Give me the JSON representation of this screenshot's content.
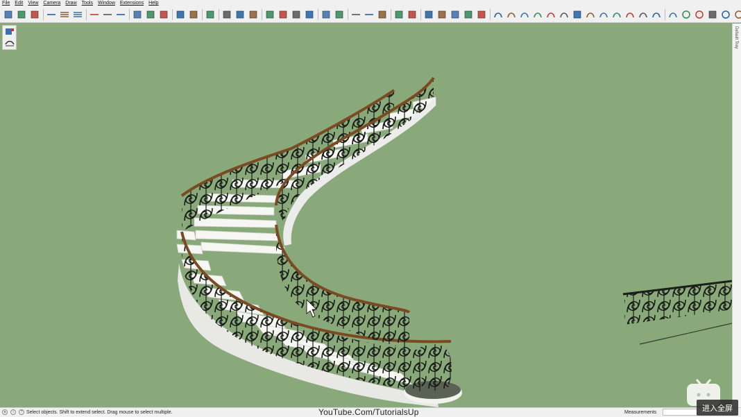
{
  "menu": [
    "File",
    "Edit",
    "View",
    "Camera",
    "Draw",
    "Tools",
    "Window",
    "Extensions",
    "Help"
  ],
  "toolbar_icons": [
    "select-icon",
    "component-icon",
    "make-group-icon",
    "sep",
    "layer-lines-icon",
    "layer-add-icon",
    "layer-del-icon",
    "sep",
    "line-short-icon",
    "line-add-icon",
    "line-remove-icon",
    "sep",
    "section-plane-icon",
    "section-fill-icon",
    "section-cut-icon",
    "sep",
    "grid-icon",
    "grid-blue-icon",
    "sep",
    "texture-grid-icon",
    "sep",
    "paint-table-icon",
    "paint-bucket-icon",
    "warehouse-icon",
    "sep",
    "checker-icon",
    "dots-icon",
    "network-icon",
    "share-icon",
    "sep",
    "grid-2x2-icon",
    "grid-quad-icon",
    "sep",
    "arrow-line-icon",
    "arrow-red-icon",
    "tile-icon",
    "sep",
    "pen-red-icon",
    "red-box-icon",
    "sep",
    "blue-diamond-icon",
    "eraser-icon",
    "warning-icon",
    "bucket-icon",
    "flag-icon",
    "sep",
    "arc-icon",
    "zigzag-icon",
    "scribble-icon",
    "wave-icon",
    "curve-icon",
    "hook-icon",
    "rounded-rect-icon",
    "spiral-icon",
    "arc-open-icon",
    "squiggle-icon",
    "corner-curve-icon",
    "small-arc-icon",
    "red-arc-icon",
    "sep",
    "zigzag-n-icon",
    "polygon-icon",
    "circle-icon",
    "wrench-icon",
    "circle-small-icon",
    "teardrop-icon"
  ],
  "mini_tools": [
    "view-icon",
    "rail-icon"
  ],
  "tray": {
    "label": "Default Tray"
  },
  "status": {
    "hint": "Select objects. Shift to extend select. Drag mouse to select multiple.",
    "measurements_label": "Measurements",
    "measurements_value": ""
  },
  "watermark": "YouTube.Com/TutorialsUp",
  "overlay": {
    "fullscreen_label": "进入全屏"
  },
  "colors": {
    "viewport_bg": "#8aa97a",
    "rail_wood": "#7a4a22",
    "iron": "#1b1f1a",
    "step_white": "#f4f4f0"
  }
}
